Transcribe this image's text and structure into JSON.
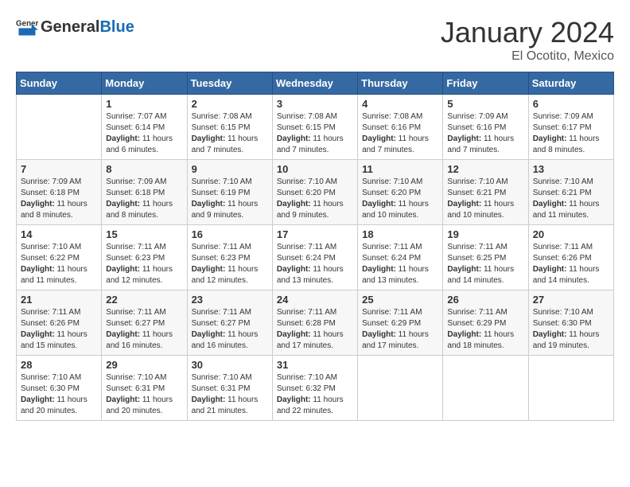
{
  "header": {
    "logo_general": "General",
    "logo_blue": "Blue",
    "month": "January 2024",
    "location": "El Ocotito, Mexico"
  },
  "calendar": {
    "days_of_week": [
      "Sunday",
      "Monday",
      "Tuesday",
      "Wednesday",
      "Thursday",
      "Friday",
      "Saturday"
    ],
    "weeks": [
      [
        {
          "day": "",
          "sunrise": "",
          "sunset": "",
          "daylight": ""
        },
        {
          "day": "1",
          "sunrise": "Sunrise: 7:07 AM",
          "sunset": "Sunset: 6:14 PM",
          "daylight": "Daylight: 11 hours and 6 minutes."
        },
        {
          "day": "2",
          "sunrise": "Sunrise: 7:08 AM",
          "sunset": "Sunset: 6:15 PM",
          "daylight": "Daylight: 11 hours and 7 minutes."
        },
        {
          "day": "3",
          "sunrise": "Sunrise: 7:08 AM",
          "sunset": "Sunset: 6:15 PM",
          "daylight": "Daylight: 11 hours and 7 minutes."
        },
        {
          "day": "4",
          "sunrise": "Sunrise: 7:08 AM",
          "sunset": "Sunset: 6:16 PM",
          "daylight": "Daylight: 11 hours and 7 minutes."
        },
        {
          "day": "5",
          "sunrise": "Sunrise: 7:09 AM",
          "sunset": "Sunset: 6:16 PM",
          "daylight": "Daylight: 11 hours and 7 minutes."
        },
        {
          "day": "6",
          "sunrise": "Sunrise: 7:09 AM",
          "sunset": "Sunset: 6:17 PM",
          "daylight": "Daylight: 11 hours and 8 minutes."
        }
      ],
      [
        {
          "day": "7",
          "sunrise": "Sunrise: 7:09 AM",
          "sunset": "Sunset: 6:18 PM",
          "daylight": "Daylight: 11 hours and 8 minutes."
        },
        {
          "day": "8",
          "sunrise": "Sunrise: 7:09 AM",
          "sunset": "Sunset: 6:18 PM",
          "daylight": "Daylight: 11 hours and 8 minutes."
        },
        {
          "day": "9",
          "sunrise": "Sunrise: 7:10 AM",
          "sunset": "Sunset: 6:19 PM",
          "daylight": "Daylight: 11 hours and 9 minutes."
        },
        {
          "day": "10",
          "sunrise": "Sunrise: 7:10 AM",
          "sunset": "Sunset: 6:20 PM",
          "daylight": "Daylight: 11 hours and 9 minutes."
        },
        {
          "day": "11",
          "sunrise": "Sunrise: 7:10 AM",
          "sunset": "Sunset: 6:20 PM",
          "daylight": "Daylight: 11 hours and 10 minutes."
        },
        {
          "day": "12",
          "sunrise": "Sunrise: 7:10 AM",
          "sunset": "Sunset: 6:21 PM",
          "daylight": "Daylight: 11 hours and 10 minutes."
        },
        {
          "day": "13",
          "sunrise": "Sunrise: 7:10 AM",
          "sunset": "Sunset: 6:21 PM",
          "daylight": "Daylight: 11 hours and 11 minutes."
        }
      ],
      [
        {
          "day": "14",
          "sunrise": "Sunrise: 7:10 AM",
          "sunset": "Sunset: 6:22 PM",
          "daylight": "Daylight: 11 hours and 11 minutes."
        },
        {
          "day": "15",
          "sunrise": "Sunrise: 7:11 AM",
          "sunset": "Sunset: 6:23 PM",
          "daylight": "Daylight: 11 hours and 12 minutes."
        },
        {
          "day": "16",
          "sunrise": "Sunrise: 7:11 AM",
          "sunset": "Sunset: 6:23 PM",
          "daylight": "Daylight: 11 hours and 12 minutes."
        },
        {
          "day": "17",
          "sunrise": "Sunrise: 7:11 AM",
          "sunset": "Sunset: 6:24 PM",
          "daylight": "Daylight: 11 hours and 13 minutes."
        },
        {
          "day": "18",
          "sunrise": "Sunrise: 7:11 AM",
          "sunset": "Sunset: 6:24 PM",
          "daylight": "Daylight: 11 hours and 13 minutes."
        },
        {
          "day": "19",
          "sunrise": "Sunrise: 7:11 AM",
          "sunset": "Sunset: 6:25 PM",
          "daylight": "Daylight: 11 hours and 14 minutes."
        },
        {
          "day": "20",
          "sunrise": "Sunrise: 7:11 AM",
          "sunset": "Sunset: 6:26 PM",
          "daylight": "Daylight: 11 hours and 14 minutes."
        }
      ],
      [
        {
          "day": "21",
          "sunrise": "Sunrise: 7:11 AM",
          "sunset": "Sunset: 6:26 PM",
          "daylight": "Daylight: 11 hours and 15 minutes."
        },
        {
          "day": "22",
          "sunrise": "Sunrise: 7:11 AM",
          "sunset": "Sunset: 6:27 PM",
          "daylight": "Daylight: 11 hours and 16 minutes."
        },
        {
          "day": "23",
          "sunrise": "Sunrise: 7:11 AM",
          "sunset": "Sunset: 6:27 PM",
          "daylight": "Daylight: 11 hours and 16 minutes."
        },
        {
          "day": "24",
          "sunrise": "Sunrise: 7:11 AM",
          "sunset": "Sunset: 6:28 PM",
          "daylight": "Daylight: 11 hours and 17 minutes."
        },
        {
          "day": "25",
          "sunrise": "Sunrise: 7:11 AM",
          "sunset": "Sunset: 6:29 PM",
          "daylight": "Daylight: 11 hours and 17 minutes."
        },
        {
          "day": "26",
          "sunrise": "Sunrise: 7:11 AM",
          "sunset": "Sunset: 6:29 PM",
          "daylight": "Daylight: 11 hours and 18 minutes."
        },
        {
          "day": "27",
          "sunrise": "Sunrise: 7:10 AM",
          "sunset": "Sunset: 6:30 PM",
          "daylight": "Daylight: 11 hours and 19 minutes."
        }
      ],
      [
        {
          "day": "28",
          "sunrise": "Sunrise: 7:10 AM",
          "sunset": "Sunset: 6:30 PM",
          "daylight": "Daylight: 11 hours and 20 minutes."
        },
        {
          "day": "29",
          "sunrise": "Sunrise: 7:10 AM",
          "sunset": "Sunset: 6:31 PM",
          "daylight": "Daylight: 11 hours and 20 minutes."
        },
        {
          "day": "30",
          "sunrise": "Sunrise: 7:10 AM",
          "sunset": "Sunset: 6:31 PM",
          "daylight": "Daylight: 11 hours and 21 minutes."
        },
        {
          "day": "31",
          "sunrise": "Sunrise: 7:10 AM",
          "sunset": "Sunset: 6:32 PM",
          "daylight": "Daylight: 11 hours and 22 minutes."
        },
        {
          "day": "",
          "sunrise": "",
          "sunset": "",
          "daylight": ""
        },
        {
          "day": "",
          "sunrise": "",
          "sunset": "",
          "daylight": ""
        },
        {
          "day": "",
          "sunrise": "",
          "sunset": "",
          "daylight": ""
        }
      ]
    ]
  }
}
